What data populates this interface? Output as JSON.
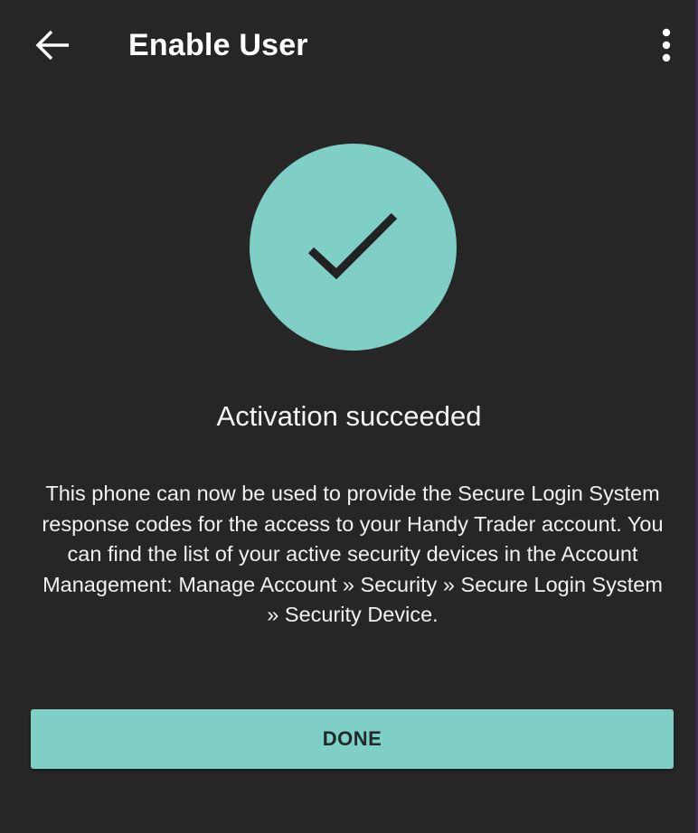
{
  "app_bar": {
    "title": "Enable User",
    "back_icon": "arrow-left-icon",
    "menu_icon": "more-vertical-icon"
  },
  "status": {
    "icon": "checkmark-icon",
    "headline": "Activation succeeded",
    "message": "This phone can now be used to provide the Secure Login System response codes for the access to your Handy Trader account. You can find the list of your active security devices in the Account Management: Manage Account » Security » Secure Login System » Security Device."
  },
  "actions": {
    "done_label": "DONE"
  },
  "colors": {
    "background": "#262626",
    "accent": "#7fcfc6",
    "text": "#ffffff"
  }
}
